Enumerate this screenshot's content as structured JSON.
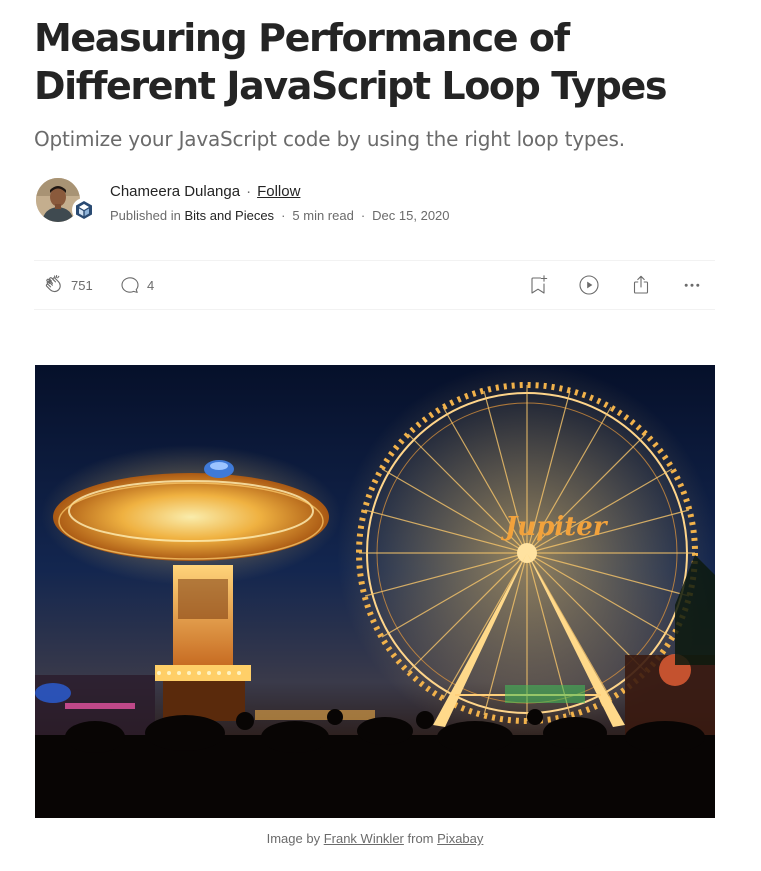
{
  "article": {
    "title": "Measuring Performance of Different JavaScript Loop Types",
    "subtitle": "Optimize your JavaScript code by using the right loop types."
  },
  "author": {
    "name": "Chameera Dulanga",
    "separator": "·",
    "follow_label": "Follow",
    "published_in_label": "Published in",
    "publication": "Bits and Pieces",
    "read_time": "5 min read",
    "date": "Dec 15, 2020"
  },
  "actions": {
    "claps": "751",
    "responses": "4",
    "icons": [
      "clap-icon",
      "comment-icon",
      "bookmark-add-icon",
      "play-icon",
      "share-icon",
      "more-icon"
    ]
  },
  "hero_image": {
    "sign_text": "Jupiter"
  },
  "caption": {
    "prefix": "Image by",
    "photographer": "Frank Winkler",
    "middle": "from",
    "source": "Pixabay"
  },
  "colors": {
    "text_primary": "#242424",
    "text_secondary": "#6b6b6b",
    "divider": "#f2f2f2",
    "sky": "#0a1530",
    "light_gold": "#f6c04a"
  }
}
